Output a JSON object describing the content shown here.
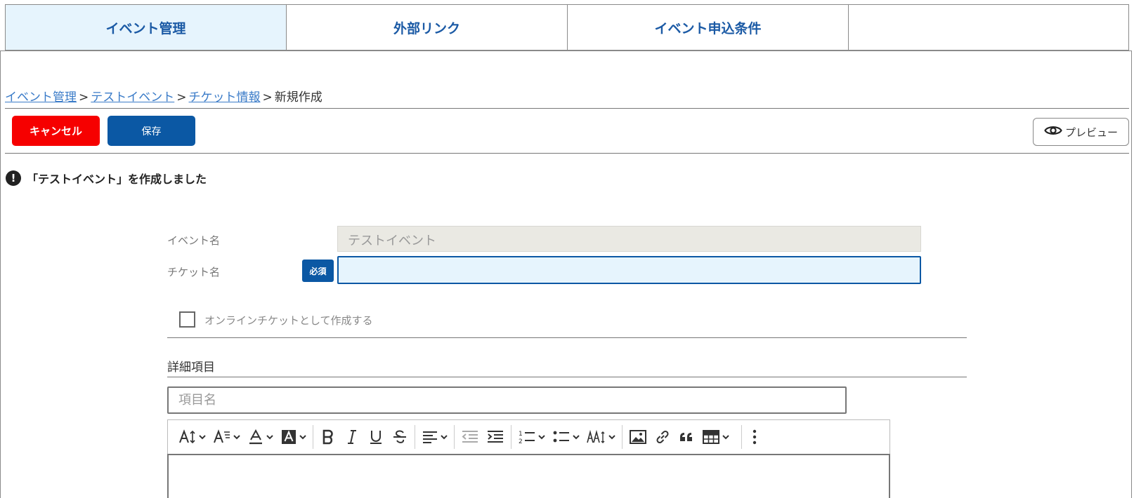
{
  "tabs": [
    {
      "label": "イベント管理",
      "active": true
    },
    {
      "label": "外部リンク",
      "active": false
    },
    {
      "label": "イベント申込条件",
      "active": false
    },
    {
      "label": "",
      "active": false
    }
  ],
  "breadcrumb": {
    "items": [
      "イベント管理",
      "テストイベント",
      "チケット情報"
    ],
    "separator": ">",
    "current": "新規作成"
  },
  "actions": {
    "cancel_label": "キャンセル",
    "save_label": "保存",
    "preview_label": "プレビュー"
  },
  "notice": {
    "icon": "!",
    "message": "「テストイベント」を作成しました"
  },
  "form": {
    "event_name_label": "イベント名",
    "event_name_value": "テストイベント",
    "ticket_name_label": "チケット名",
    "required_badge": "必須",
    "ticket_name_value": "",
    "online_ticket_label": "オンラインチケットとして作成する",
    "details_title": "詳細項目",
    "item_name_placeholder": "項目名"
  },
  "colors": {
    "accent": "#0b58a4",
    "danger": "#f60000",
    "tab_active_bg": "#e6f4fd",
    "link": "#3a7bc8"
  },
  "toolbar_icons": [
    "font-size-icon",
    "font-family-icon",
    "font-color-icon",
    "font-background-color-icon",
    "bold-icon",
    "italic-icon",
    "underline-icon",
    "strikethrough-icon",
    "align-icon",
    "outdent-icon",
    "indent-icon",
    "numbered-list-icon",
    "bulleted-list-icon",
    "text-transform-icon",
    "image-icon",
    "link-icon",
    "blockquote-icon",
    "table-icon",
    "more-icon"
  ]
}
